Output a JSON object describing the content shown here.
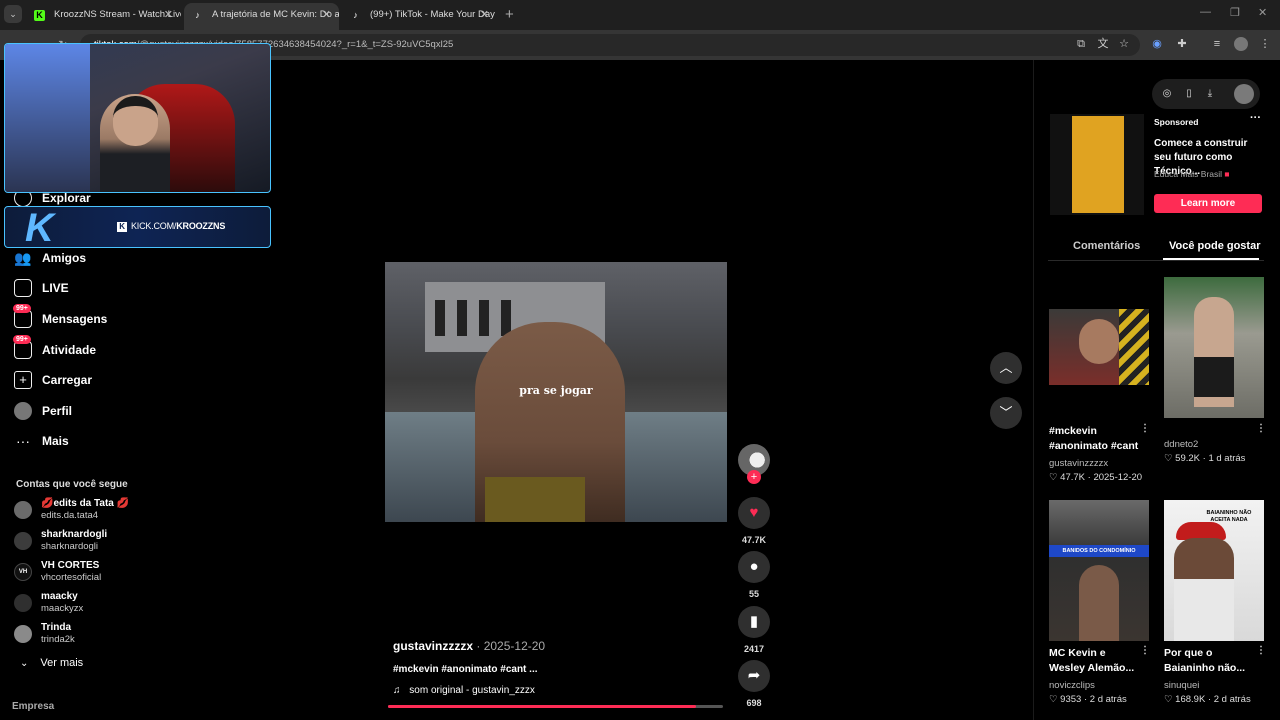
{
  "browser": {
    "tabs": [
      {
        "title": "KroozzNS Stream - Watch Live on",
        "favicon": "kick-icon"
      },
      {
        "title": "A trajetória de MC Kevin: Do anon",
        "favicon": "tiktok-icon"
      },
      {
        "title": "(99+) TikTok - Make Your Day",
        "favicon": "tiktok-icon"
      }
    ],
    "url_host": "tiktok.com",
    "url_rest": "/@gustavinzzzzx/video/7585772634638454024?_r=1&_t=ZS-92uVC5qxl25"
  },
  "overlay": {
    "kick_url": "KICK.COM/",
    "kick_channel": "KROOZZNS"
  },
  "sidebar": {
    "nav": [
      {
        "label": "Explorar",
        "icon": "compass-icon"
      },
      {
        "label": "Amigos",
        "icon": "friends-icon"
      },
      {
        "label": "LIVE",
        "icon": "live-icon"
      },
      {
        "label": "Mensagens",
        "icon": "messages-icon",
        "badge": "99+"
      },
      {
        "label": "Atividade",
        "icon": "activity-icon",
        "badge": "99+"
      },
      {
        "label": "Carregar",
        "icon": "upload-icon"
      },
      {
        "label": "Perfil",
        "icon": "profile-icon"
      },
      {
        "label": "Mais",
        "icon": "more-icon"
      }
    ],
    "following_title": "Contas que você segue",
    "following": [
      {
        "name": "💋edits da Tata 💋",
        "user": "edits.da.tata4"
      },
      {
        "name": "sharknardogli",
        "user": "sharknardogli"
      },
      {
        "name": "VH CORTES",
        "user": "vhcortesoficial"
      },
      {
        "name": "maacky",
        "user": "maackyzx"
      },
      {
        "name": "Trinda",
        "user": "trinda2k"
      }
    ],
    "see_more": "Ver mais",
    "company": "Empresa"
  },
  "video": {
    "caption_overlay": "pra se jogar",
    "author": "gustavinzzzzx",
    "date": "2025-12-20",
    "description": "#mckevin #anonimato #cant ...",
    "sound": "som original - gustavin_zzzx",
    "progress": 0.92,
    "likes": "47.7K",
    "comments": "55",
    "saves": "2417",
    "shares": "698"
  },
  "right": {
    "ad": {
      "label": "Sponsored",
      "title": "Comece a construir seu futuro como Técnico...",
      "brand": "Educa Mais Brasil",
      "cta": "Learn more"
    },
    "tabs": {
      "comments": "Comentários",
      "you_may_like": "Você pode gostar"
    },
    "cards": [
      {
        "title1": "#mckevin",
        "title2": "#anonimato #cant",
        "user": "gustavinzzzzx",
        "likes": "47.7K",
        "date": "2025-12-20"
      },
      {
        "title1": "",
        "title2": "",
        "user": "ddneto2",
        "likes": "59.2K",
        "date": "1 d atrás"
      },
      {
        "title1": "MC Kevin e",
        "title2": "Wesley Alemão...",
        "user": "noviczclips",
        "likes": "9353",
        "date": "2 d atrás",
        "thumb_text": "BANIDOS DO CONDOMÍNIO"
      },
      {
        "title1": "Por que o",
        "title2": "Baianinho não...",
        "user": "sinuquei",
        "likes": "168.9K",
        "date": "2 d atrás",
        "thumb_text": "BAIANINHO NÃO ACEITA NADA"
      }
    ]
  },
  "colors": {
    "accent": "#fe2c55",
    "kick_border": "#49c3ff",
    "ad_yellow": "#e0a321"
  }
}
